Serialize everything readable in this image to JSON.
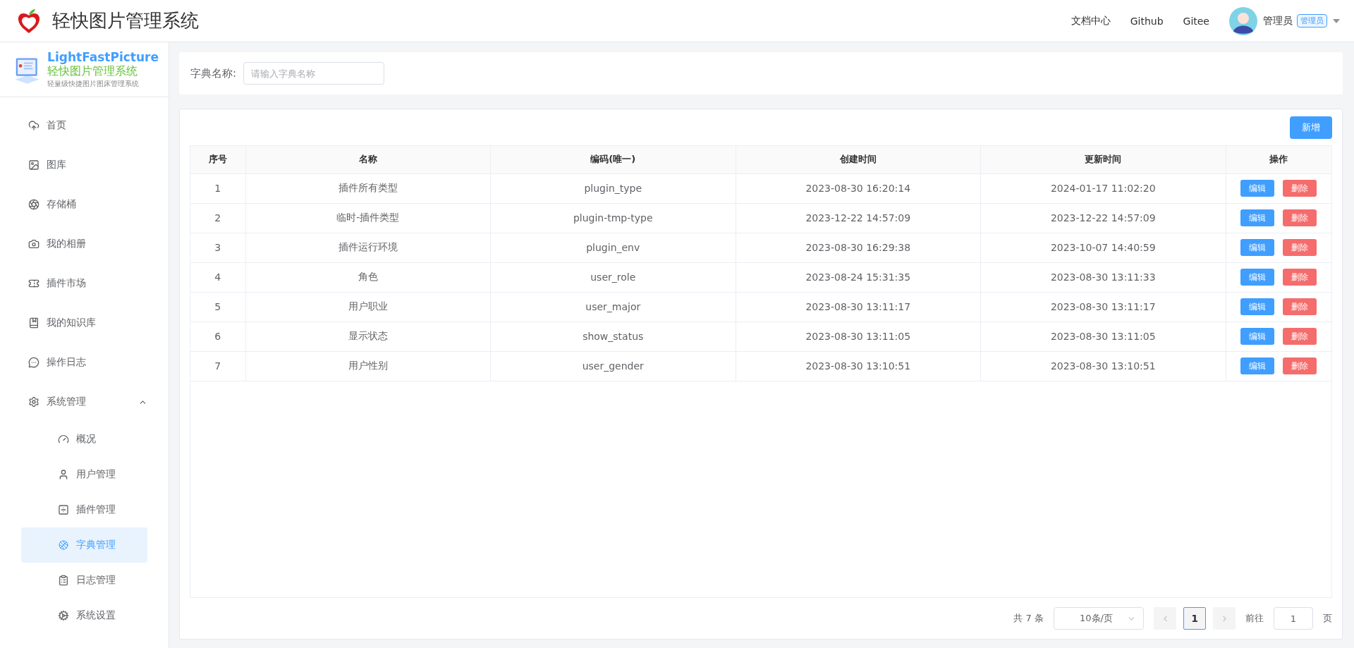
{
  "header": {
    "title": "轻快图片管理系统",
    "links": [
      "文档中心",
      "Github",
      "Gitee"
    ],
    "user": {
      "name": "管理员",
      "role": "管理员"
    }
  },
  "brand": {
    "name": "LightFastPicture",
    "title": "轻快图片管理系统",
    "subtitle": "轻量级快捷图片图床管理系统"
  },
  "sidebar": {
    "items": [
      {
        "label": "首页",
        "selected": false
      },
      {
        "label": "图库",
        "selected": false
      },
      {
        "label": "存储桶",
        "selected": false
      },
      {
        "label": "我的相册",
        "selected": false
      },
      {
        "label": "插件市场",
        "selected": false
      },
      {
        "label": "我的知识库",
        "selected": false
      },
      {
        "label": "操作日志",
        "selected": false
      },
      {
        "label": "系统管理",
        "selected": false,
        "expanded": true,
        "children": [
          {
            "label": "概况",
            "selected": false
          },
          {
            "label": "用户管理",
            "selected": false
          },
          {
            "label": "插件管理",
            "selected": false
          },
          {
            "label": "字典管理",
            "selected": true
          },
          {
            "label": "日志管理",
            "selected": false
          },
          {
            "label": "系统设置",
            "selected": false
          }
        ]
      }
    ]
  },
  "search": {
    "label": "字典名称:",
    "placeholder": "请输入字典名称"
  },
  "add_button": "新增",
  "table": {
    "columns": [
      "序号",
      "名称",
      "编码(唯一)",
      "创建时间",
      "更新时间",
      "操作"
    ],
    "rows": [
      {
        "cells": [
          "1",
          "插件所有类型",
          "plugin_type",
          "2023-08-30 16:20:14",
          "2024-01-17 11:02:20"
        ],
        "actions": [
          {
            "label": "编辑",
            "kind": "edit"
          },
          {
            "label": "删除",
            "kind": "delete"
          }
        ]
      },
      {
        "cells": [
          "2",
          "临时-插件类型",
          "plugin-tmp-type",
          "2023-12-22 14:57:09",
          "2023-12-22 14:57:09"
        ],
        "actions": [
          {
            "label": "编辑",
            "kind": "edit"
          },
          {
            "label": "删除",
            "kind": "delete"
          }
        ]
      },
      {
        "cells": [
          "3",
          "插件运行环境",
          "plugin_env",
          "2023-08-30 16:29:38",
          "2023-10-07 14:40:59"
        ],
        "actions": [
          {
            "label": "编辑",
            "kind": "edit"
          },
          {
            "label": "删除",
            "kind": "delete"
          }
        ]
      },
      {
        "cells": [
          "4",
          "角色",
          "user_role",
          "2023-08-24 15:31:35",
          "2023-08-30 13:11:33"
        ],
        "actions": [
          {
            "label": "编辑",
            "kind": "edit"
          },
          {
            "label": "删除",
            "kind": "delete"
          }
        ]
      },
      {
        "cells": [
          "5",
          "用户职业",
          "user_major",
          "2023-08-30 13:11:17",
          "2023-08-30 13:11:17"
        ],
        "actions": [
          {
            "label": "编辑",
            "kind": "edit"
          },
          {
            "label": "删除",
            "kind": "delete"
          }
        ]
      },
      {
        "cells": [
          "6",
          "显示状态",
          "show_status",
          "2023-08-30 13:11:05",
          "2023-08-30 13:11:05"
        ],
        "actions": [
          {
            "label": "编辑",
            "kind": "edit"
          },
          {
            "label": "删除",
            "kind": "delete"
          }
        ]
      },
      {
        "cells": [
          "7",
          "用户性别",
          "user_gender",
          "2023-08-30 13:10:51",
          "2023-08-30 13:10:51"
        ],
        "actions": [
          {
            "label": "编辑",
            "kind": "edit"
          },
          {
            "label": "删除",
            "kind": "delete"
          }
        ]
      }
    ]
  },
  "pagination": {
    "total": "共 7 条",
    "page_size": "10条/页",
    "pages": [
      {
        "label": "1",
        "selected": true
      }
    ],
    "goto_label": "前往",
    "goto_value": "1",
    "goto_suffix": "页"
  }
}
